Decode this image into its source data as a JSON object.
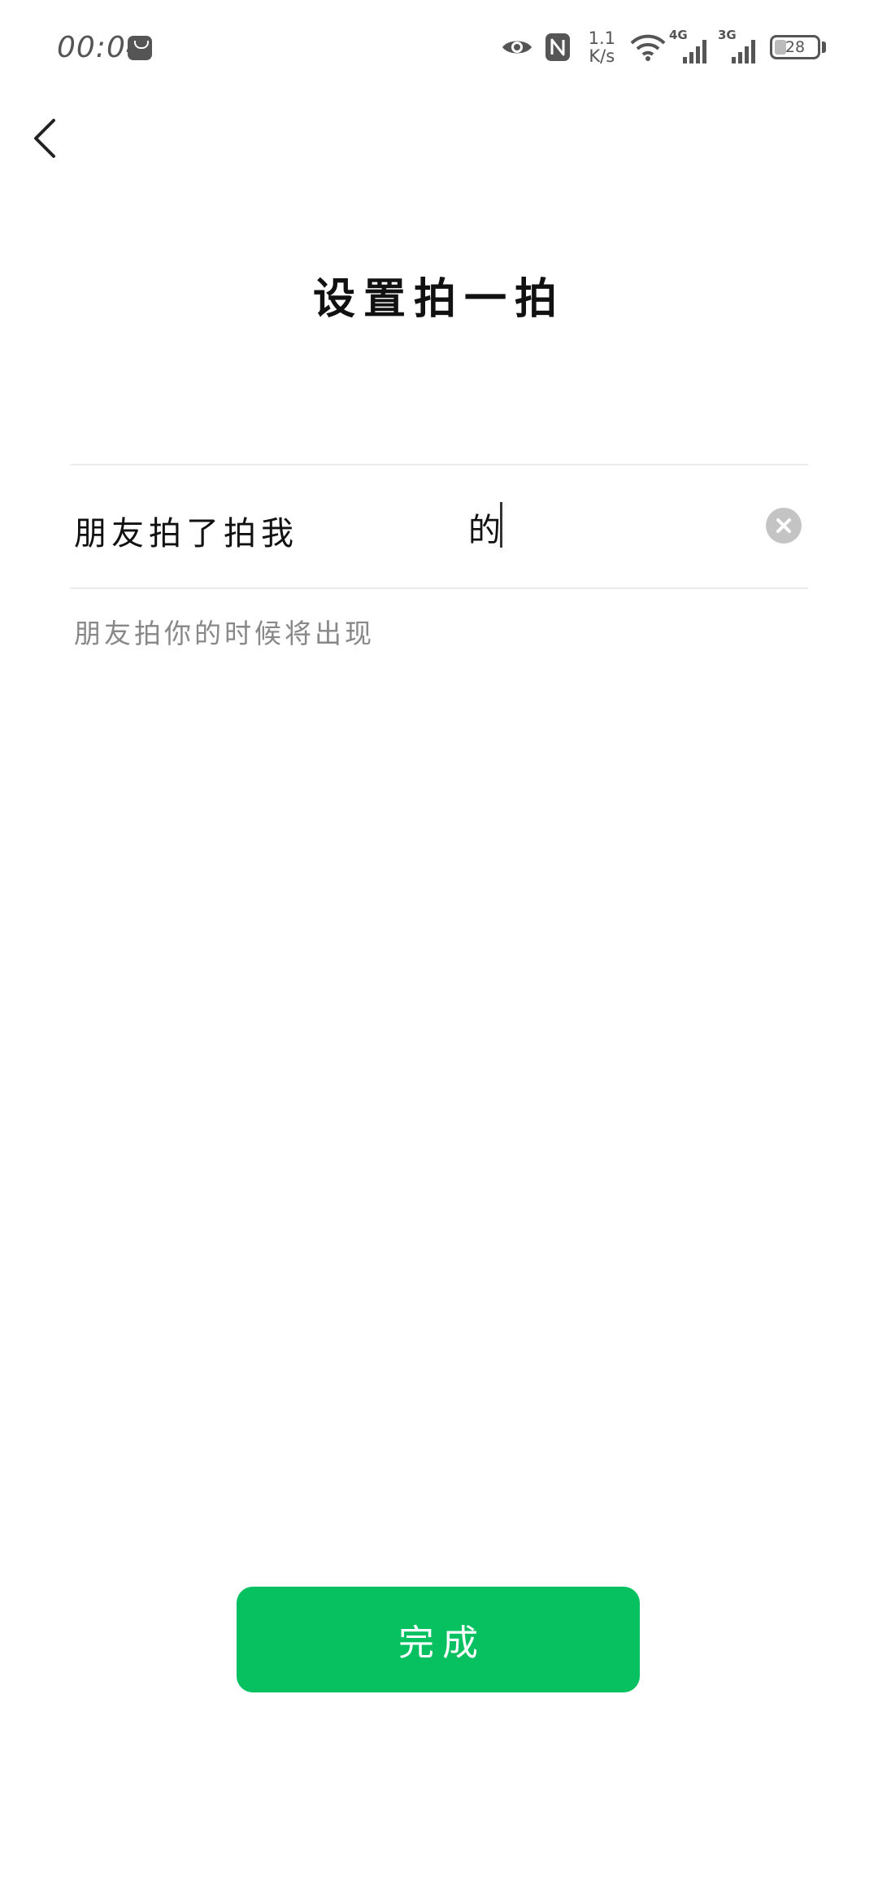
{
  "status_bar": {
    "time": "00:04",
    "net_speed_value": "1.1",
    "net_speed_unit": "K/s",
    "network_tag_1": "4G",
    "network_tag_2": "3G",
    "battery_percent": "28",
    "battery_level": 0.28,
    "icons": [
      "huawei-appgallery-icon",
      "eye-icon",
      "nfc-icon",
      "wifi-icon",
      "signal-icon",
      "battery-icon"
    ]
  },
  "header": {
    "back_icon": "chevron-left-icon",
    "title": "设置拍一拍"
  },
  "tickle_input": {
    "prefix": "朋友拍了拍我",
    "value": "的",
    "clear_icon": "clear-circle-icon"
  },
  "hint": "朋友拍你的时候将出现",
  "done_button_label": "完成",
  "colors": {
    "accent_green": "#07c160",
    "text_primary": "#111111",
    "text_hint": "#888888",
    "divider": "#ececec",
    "clear_icon_bg": "#c4c4c4"
  }
}
